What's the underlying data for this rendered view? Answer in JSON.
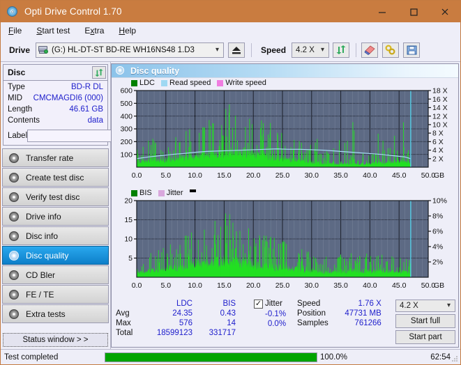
{
  "window": {
    "title": "Opti Drive Control 1.70",
    "app_icon": "disc-icon",
    "titlebar_color": "#c97c40",
    "minimize_label": "–",
    "maximize_label": "□",
    "close_label": "✕"
  },
  "menu": {
    "items": [
      {
        "label": "File",
        "mnemonic": "F"
      },
      {
        "label": "Start test",
        "mnemonic": "S"
      },
      {
        "label": "Extra",
        "mnemonic": "x"
      },
      {
        "label": "Help",
        "mnemonic": "H"
      }
    ]
  },
  "toolbar": {
    "drive_label": "Drive",
    "drive_value": "(G:)  HL-DT-ST BD-RE  WH16NS48 1.D3",
    "drive_icon": "optical-drive-icon",
    "eject_icon": "eject-icon",
    "speed_label": "Speed",
    "speed_value": "4.2 X",
    "refresh_icon": "refresh-icon",
    "erase_icon": "eraser-icon",
    "tools_icon": "wrench-icon",
    "save_icon": "floppy-save-icon"
  },
  "disc_panel": {
    "title": "Disc",
    "refresh_icon": "refresh-icon",
    "rows": [
      {
        "key": "Type",
        "value": "BD-R DL"
      },
      {
        "key": "MID",
        "value": "CMCMAGDI6 (000)"
      },
      {
        "key": "Length",
        "value": "46.61 GB"
      },
      {
        "key": "Contents",
        "value": "data"
      }
    ],
    "label_key": "Label",
    "label_value": "",
    "label_placeholder": "",
    "disc_button_icon": "disc-icon"
  },
  "sidebar": {
    "items": [
      {
        "label": "Transfer rate",
        "icon": "disc-test-icon",
        "active": false
      },
      {
        "label": "Create test disc",
        "icon": "disc-burn-icon",
        "active": false
      },
      {
        "label": "Verify test disc",
        "icon": "disc-verify-icon",
        "active": false
      },
      {
        "label": "Drive info",
        "icon": "disc-info-icon",
        "active": false
      },
      {
        "label": "Disc info",
        "icon": "disc-info-icon",
        "active": false
      },
      {
        "label": "Disc quality",
        "icon": "disc-quality-icon",
        "active": true
      },
      {
        "label": "CD Bler",
        "icon": "disc-bler-icon",
        "active": false
      },
      {
        "label": "FE / TE",
        "icon": "disc-fete-icon",
        "active": false
      },
      {
        "label": "Extra tests",
        "icon": "disc-extra-icon",
        "active": false
      }
    ],
    "status_window_button": "Status window > >"
  },
  "main": {
    "title": "Disc quality",
    "title_icon": "disc-quality-icon"
  },
  "stats": {
    "columns": [
      "LDC",
      "BIS"
    ],
    "rows": [
      {
        "key": "Avg",
        "ldc": "24.35",
        "bis": "0.43"
      },
      {
        "key": "Max",
        "ldc": "576",
        "bis": "14"
      },
      {
        "key": "Total",
        "ldc": "18599123",
        "bis": "331717"
      }
    ],
    "jitter": {
      "checked": true,
      "label": "Jitter",
      "check_glyph": "✓",
      "values": [
        "-0.1%",
        "0.0%"
      ]
    },
    "readout": [
      {
        "key": "Speed",
        "value": "1.76 X"
      },
      {
        "key": "Position",
        "value": "47731 MB"
      },
      {
        "key": "Samples",
        "value": "761266"
      }
    ],
    "speed_select": "4.2 X",
    "start_full_label": "Start full",
    "start_part_label": "Start part"
  },
  "statusbar": {
    "message": "Test completed",
    "progress_percent": 100.0,
    "progress_text": "100.0%",
    "elapsed": "62:54",
    "progress_color": "#00a400"
  },
  "chart_data": [
    {
      "type": "line",
      "id": "ldc-chart",
      "title": "",
      "xlabel": "GB",
      "ylabel": "",
      "xlim": [
        0,
        50
      ],
      "xticks": [
        "0.0",
        "5.0",
        "10.0",
        "15.0",
        "20.0",
        "25.0",
        "30.0",
        "35.0",
        "40.0",
        "45.0",
        "50.0"
      ],
      "ylim": [
        0,
        600
      ],
      "yticks": [
        "100",
        "200",
        "300",
        "400",
        "500",
        "600"
      ],
      "y2lim": [
        0,
        18
      ],
      "y2ticks": [
        "2 X",
        "4 X",
        "6 X",
        "8 X",
        "10 X",
        "12 X",
        "14 X",
        "16 X",
        "18 X"
      ],
      "grid": true,
      "plot_bg": "#5d6a84",
      "legend_position": "top-left",
      "legend": [
        {
          "name": "LDC",
          "color": "#008000"
        },
        {
          "name": "Read speed",
          "color": "#9fd8f2"
        },
        {
          "name": "Write speed",
          "color": "#f07de0"
        }
      ],
      "series": [
        {
          "name": "LDC",
          "color": "#22e022",
          "kind": "area-spikes",
          "x": [
            0,
            1,
            2,
            3,
            4,
            5,
            6,
            7,
            8,
            9,
            10,
            11,
            12,
            13,
            14,
            15,
            16,
            17,
            18,
            19,
            20,
            21,
            22,
            23,
            24,
            25,
            26,
            27,
            28,
            29,
            30,
            31,
            32,
            33,
            34,
            35,
            36,
            37,
            38,
            39,
            40,
            41,
            42,
            43,
            44,
            45,
            46,
            47
          ],
          "baseline": [
            35,
            50,
            60,
            62,
            58,
            60,
            65,
            72,
            78,
            85,
            92,
            95,
            100,
            105,
            110,
            118,
            122,
            120,
            118,
            112,
            105,
            100,
            92,
            85,
            78,
            70,
            62,
            55,
            48,
            42,
            38,
            34,
            30,
            28,
            26,
            25,
            25,
            26,
            28,
            30,
            32,
            35,
            38,
            42,
            46,
            48,
            45,
            0
          ],
          "peaks": [
            70,
            305,
            412,
            320,
            272,
            240,
            300,
            210,
            400,
            250,
            397,
            345,
            365,
            230,
            180,
            545,
            420,
            260,
            200,
            175,
            360,
            300,
            415,
            285,
            250,
            410,
            240,
            300,
            240,
            215,
            300,
            170,
            150,
            150,
            330,
            375,
            400,
            390,
            415,
            280,
            300,
            350,
            265,
            250,
            400,
            380,
            250,
            0
          ]
        },
        {
          "name": "Read speed",
          "color": "#a5dcf5",
          "kind": "line",
          "x": [
            0,
            2,
            4,
            6,
            8,
            10,
            12,
            14,
            16,
            18,
            20,
            22,
            24,
            26,
            28,
            30,
            32,
            34,
            36,
            38,
            40,
            42,
            44,
            46,
            47
          ],
          "y_speed_x": [
            2.0,
            2.4,
            2.7,
            3.0,
            3.2,
            3.5,
            3.7,
            3.8,
            3.9,
            4.0,
            4.1,
            4.2,
            4.3,
            4.2,
            4.2,
            4.1,
            4.0,
            3.8,
            3.6,
            3.4,
            3.2,
            3.0,
            2.7,
            2.4,
            2.0
          ]
        },
        {
          "name": "cursor",
          "color": "#55d8f0",
          "kind": "vline",
          "x": 47
        }
      ]
    },
    {
      "type": "line",
      "id": "bis-jitter-chart",
      "title": "",
      "xlabel": "GB",
      "ylabel": "",
      "xlim": [
        0,
        50
      ],
      "xticks": [
        "0.0",
        "5.0",
        "10.0",
        "15.0",
        "20.0",
        "25.0",
        "30.0",
        "35.0",
        "40.0",
        "45.0",
        "50.0"
      ],
      "ylim": [
        0,
        20
      ],
      "yticks": [
        "5",
        "10",
        "15",
        "20"
      ],
      "y2lim": [
        0,
        10
      ],
      "y2ticks": [
        "2%",
        "4%",
        "6%",
        "8%",
        "10%"
      ],
      "grid": true,
      "plot_bg": "#5d6a84",
      "legend_position": "top-left",
      "legend": [
        {
          "name": "BIS",
          "color": "#008000"
        },
        {
          "name": "Jitter",
          "color": "#d9a8dd"
        }
      ],
      "series": [
        {
          "name": "BIS",
          "color": "#22e022",
          "kind": "area-spikes",
          "x": [
            0,
            1,
            2,
            3,
            4,
            5,
            6,
            7,
            8,
            9,
            10,
            11,
            12,
            13,
            14,
            15,
            16,
            17,
            18,
            19,
            20,
            21,
            22,
            23,
            24,
            25,
            26,
            27,
            28,
            29,
            30,
            31,
            32,
            33,
            34,
            35,
            36,
            37,
            38,
            39,
            40,
            41,
            42,
            43,
            44,
            45,
            46,
            47
          ],
          "baseline": [
            1.2,
            1.6,
            1.8,
            1.9,
            2.0,
            2.1,
            2.4,
            2.6,
            2.9,
            3.1,
            3.4,
            3.6,
            3.8,
            4.0,
            4.2,
            4.4,
            4.4,
            4.2,
            4.0,
            3.7,
            3.4,
            3.1,
            2.9,
            2.8,
            2.7,
            2.5,
            2.3,
            2.1,
            1.9,
            1.7,
            1.6,
            1.5,
            1.4,
            1.4,
            1.5,
            1.6,
            1.8,
            1.9,
            1.8,
            1.7,
            1.6,
            1.6,
            1.5,
            1.5,
            1.5,
            1.4,
            1.3,
            0
          ],
          "peaks": [
            8.0,
            5.4,
            9.0,
            6.8,
            4.6,
            4.2,
            5.6,
            5.0,
            9.2,
            6.2,
            7.6,
            6.4,
            6.8,
            6.0,
            11.0,
            14.0,
            12.1,
            6.2,
            5.6,
            5.4,
            5.2,
            8.0,
            6.0,
            11.0,
            8.8,
            5.8,
            4.6,
            4.4,
            4.2,
            4.0,
            4.2,
            3.6,
            3.0,
            3.2,
            3.8,
            4.4,
            4.2,
            4.0,
            4.4,
            3.8,
            4.2,
            4.4,
            3.2,
            3.4,
            4.2,
            4.4,
            6.0,
            0
          ]
        },
        {
          "name": "cursor",
          "color": "#55d8f0",
          "kind": "vline",
          "x": 47
        }
      ]
    }
  ]
}
